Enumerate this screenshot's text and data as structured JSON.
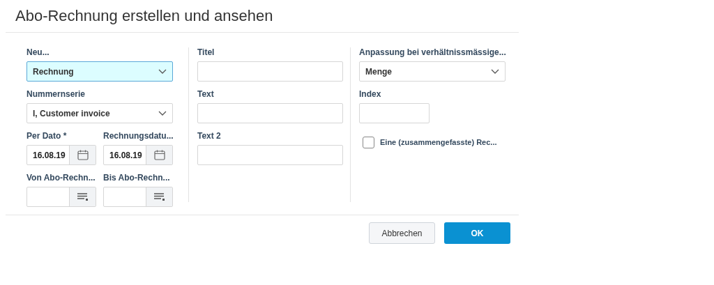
{
  "title": "Abo-Rechnung erstellen und ansehen",
  "columns": [
    {
      "fields": [
        {
          "kind": "select",
          "label": "Neu...",
          "value": "Rechnung",
          "focused": true
        },
        {
          "kind": "select",
          "label": "Nummernserie",
          "value": "I, Customer invoice",
          "focused": false
        },
        {
          "kind": "pair",
          "children": [
            {
              "kind": "date",
              "label": "Per Dato *",
              "value": "16.08.19"
            },
            {
              "kind": "date",
              "label": "Rechnungsdatu...",
              "value": "16.08.19"
            }
          ]
        },
        {
          "kind": "pair",
          "children": [
            {
              "kind": "lookup",
              "label": "Von Abo-Rechn..."
            },
            {
              "kind": "lookup",
              "label": "Bis Abo-Rechn..."
            }
          ]
        }
      ]
    },
    {
      "fields": [
        {
          "kind": "text",
          "label": "Titel"
        },
        {
          "kind": "text",
          "label": "Text"
        },
        {
          "kind": "text",
          "label": "Text 2"
        }
      ]
    },
    {
      "fields": [
        {
          "kind": "select",
          "label": "Anpassung bei verhältnissmässige...",
          "value": "Menge",
          "focused": false
        },
        {
          "kind": "short",
          "label": "Index"
        },
        {
          "kind": "checkbox",
          "label": "Eine (zusammengefasste) Rec...",
          "checked": false
        }
      ]
    }
  ],
  "buttons": [
    {
      "kind": "secondary",
      "label": "Abbrechen"
    },
    {
      "kind": "primary",
      "label": "OK"
    }
  ]
}
